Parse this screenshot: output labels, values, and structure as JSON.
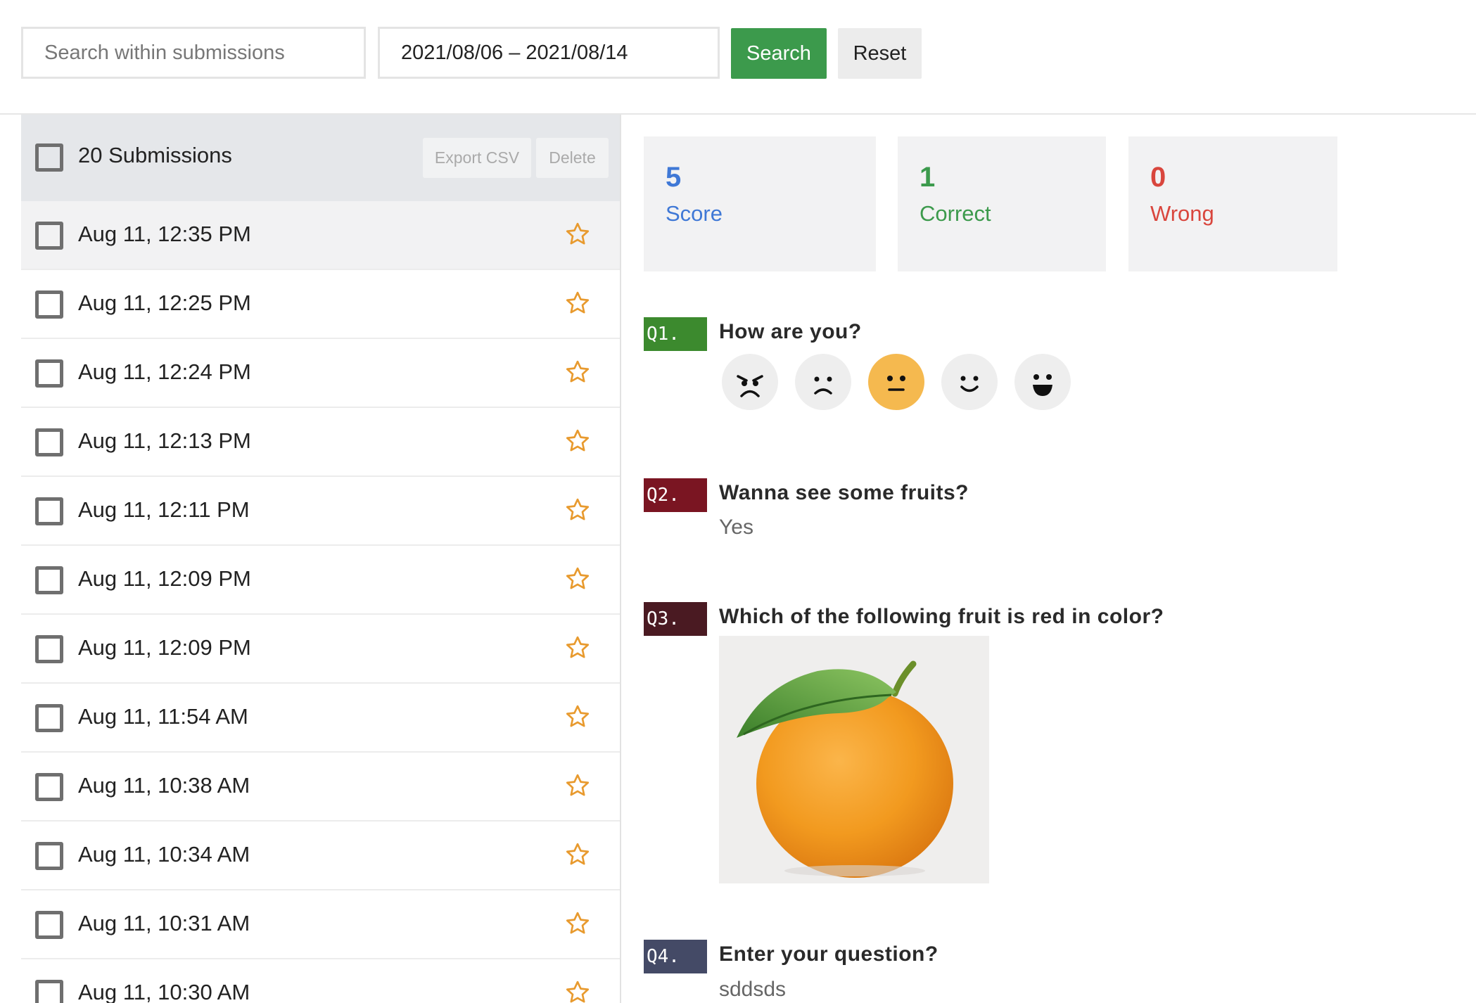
{
  "toolbar": {
    "search_placeholder": "Search within submissions",
    "date_range": "2021/08/06 – 2021/08/14",
    "search_label": "Search",
    "reset_label": "Reset"
  },
  "list": {
    "header_label": "20 Submissions",
    "export_label": "Export CSV",
    "delete_label": "Delete",
    "rows": [
      "Aug 11, 12:35 PM",
      "Aug 11, 12:25 PM",
      "Aug 11, 12:24 PM",
      "Aug 11, 12:13 PM",
      "Aug 11, 12:11 PM",
      "Aug 11, 12:09 PM",
      "Aug 11, 12:09 PM",
      "Aug 11, 11:54 AM",
      "Aug 11, 10:38 AM",
      "Aug 11, 10:34 AM",
      "Aug 11, 10:31 AM",
      "Aug 11, 10:30 AM"
    ]
  },
  "stats": {
    "score": {
      "value": "5",
      "label": "Score",
      "color": "#3f78d6"
    },
    "correct": {
      "value": "1",
      "label": "Correct",
      "color": "#3c9a4c"
    },
    "wrong": {
      "value": "0",
      "label": "Wrong",
      "color": "#d9463d"
    }
  },
  "questions": {
    "q1": {
      "badge": "Q1.",
      "title": "How are you?",
      "badge_color": "#3c8a2e",
      "selected_rating": 3,
      "rating_scale": 5
    },
    "q2": {
      "badge": "Q2.",
      "title": "Wanna see some fruits?",
      "answer": "Yes",
      "badge_color": "#7a1522"
    },
    "q3": {
      "badge": "Q3.",
      "title": "Which of the following fruit is red in color?",
      "answer_image": "orange-fruit",
      "badge_color": "#4a1a22"
    },
    "q4": {
      "badge": "Q4.",
      "title": "Enter your question?",
      "answer": "sddsds",
      "badge_color": "#444a66"
    }
  },
  "colors": {
    "star": "#e89a2e",
    "selected_face": "#f5b94f"
  }
}
